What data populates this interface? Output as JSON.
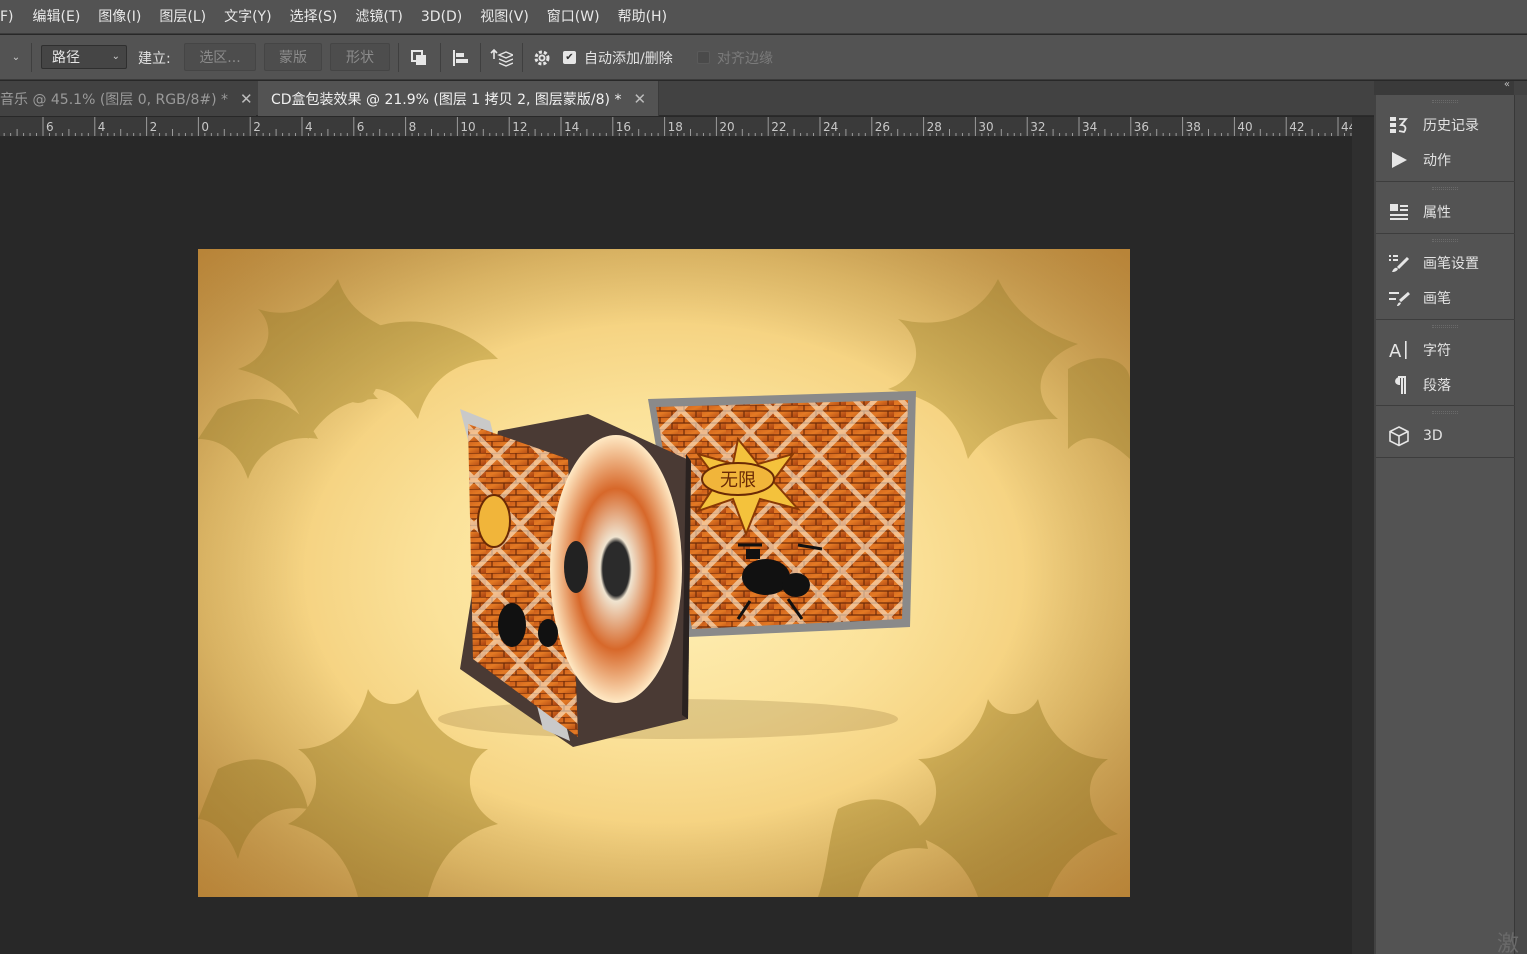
{
  "menubar": {
    "items": [
      "F)",
      "编辑(E)",
      "图像(I)",
      "图层(L)",
      "文字(Y)",
      "选择(S)",
      "滤镜(T)",
      "3D(D)",
      "视图(V)",
      "窗口(W)",
      "帮助(H)"
    ]
  },
  "options": {
    "mode_value": "路径",
    "make_label": "建立:",
    "selection_btn": "选区...",
    "mask_btn": "蒙版",
    "shape_btn": "形状",
    "auto_add_label": "自动添加/删除",
    "auto_add_checked": true,
    "align_edges_label": "对齐边缘",
    "align_edges_checked": false
  },
  "tabs": [
    {
      "title": "音乐 @ 45.1% (图层 0, RGB/8#) *",
      "active": false
    },
    {
      "title": "CD盒包装效果 @ 21.9% (图层 1 拷贝 2, 图层蒙版/8) *",
      "active": true
    }
  ],
  "ruler": {
    "labels": [
      "6",
      "4",
      "2",
      "0",
      "2",
      "4",
      "6",
      "8",
      "10",
      "12",
      "14",
      "16",
      "18",
      "20",
      "22",
      "24",
      "26",
      "28",
      "30",
      "32",
      "34",
      "36",
      "38",
      "40",
      "42",
      "44"
    ]
  },
  "artwork": {
    "cover_badge_text": "无限"
  },
  "panels": {
    "groups": [
      [
        {
          "label": "历史记录",
          "icon": "history-icon"
        },
        {
          "label": "动作",
          "icon": "actions-play-icon"
        }
      ],
      [
        {
          "label": "属性",
          "icon": "properties-icon"
        }
      ],
      [
        {
          "label": "画笔设置",
          "icon": "brush-settings-icon"
        },
        {
          "label": "画笔",
          "icon": "brush-icon"
        }
      ],
      [
        {
          "label": "字符",
          "icon": "character-icon"
        },
        {
          "label": "段落",
          "icon": "paragraph-icon"
        }
      ],
      [
        {
          "label": "3D",
          "icon": "3d-cube-icon"
        }
      ]
    ]
  },
  "watermark_text": "激"
}
